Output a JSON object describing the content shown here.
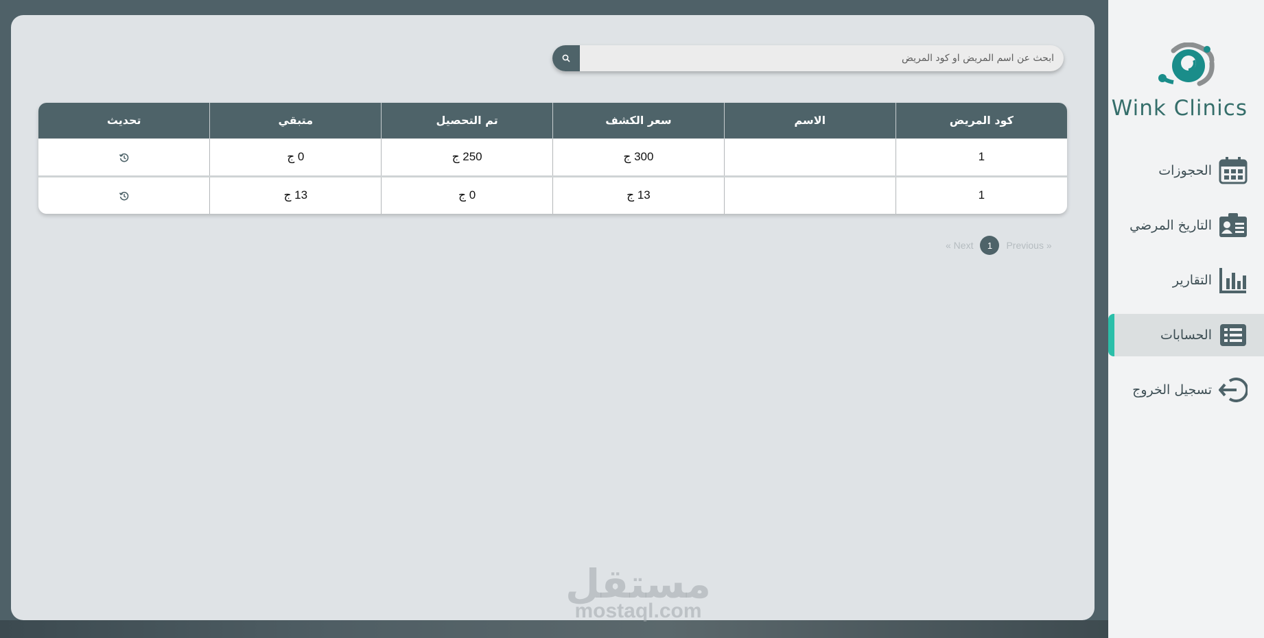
{
  "app": {
    "logo_text": "Wink Clinics"
  },
  "sidebar": {
    "items": [
      {
        "label": "الحجوزات",
        "icon": "calendar-icon",
        "active": false
      },
      {
        "label": "التاريخ المرضي",
        "icon": "id-card-icon",
        "active": false
      },
      {
        "label": "التقارير",
        "icon": "bar-chart-icon",
        "active": false
      },
      {
        "label": "الحسابات",
        "icon": "list-icon",
        "active": true
      },
      {
        "label": "تسجيل الخروج",
        "icon": "logout-icon",
        "active": false
      }
    ]
  },
  "search": {
    "placeholder": "ابحث عن اسم المريض او كود المريض",
    "icon": "search-icon"
  },
  "table": {
    "headers": [
      "كود المريض",
      "الاسم",
      "سعر الكشف",
      "تم التحصيل",
      "متبقي",
      "تحديث"
    ],
    "rows": [
      {
        "code": "1",
        "name": "",
        "fee": "300 ج",
        "collected": "250 ج",
        "remaining": "0 ج"
      },
      {
        "code": "1",
        "name": "",
        "fee": "13 ج",
        "collected": "0 ج",
        "remaining": "13 ج"
      }
    ]
  },
  "pagination": {
    "previous": "Previous »",
    "page": "1",
    "next": "« Next"
  },
  "watermark": {
    "arabic": "مستقل",
    "latin": "mostaql.com"
  },
  "colors": {
    "brand": "#4e6369",
    "accent": "#2bbfa9",
    "logo_teal": "#1a8d8a"
  }
}
